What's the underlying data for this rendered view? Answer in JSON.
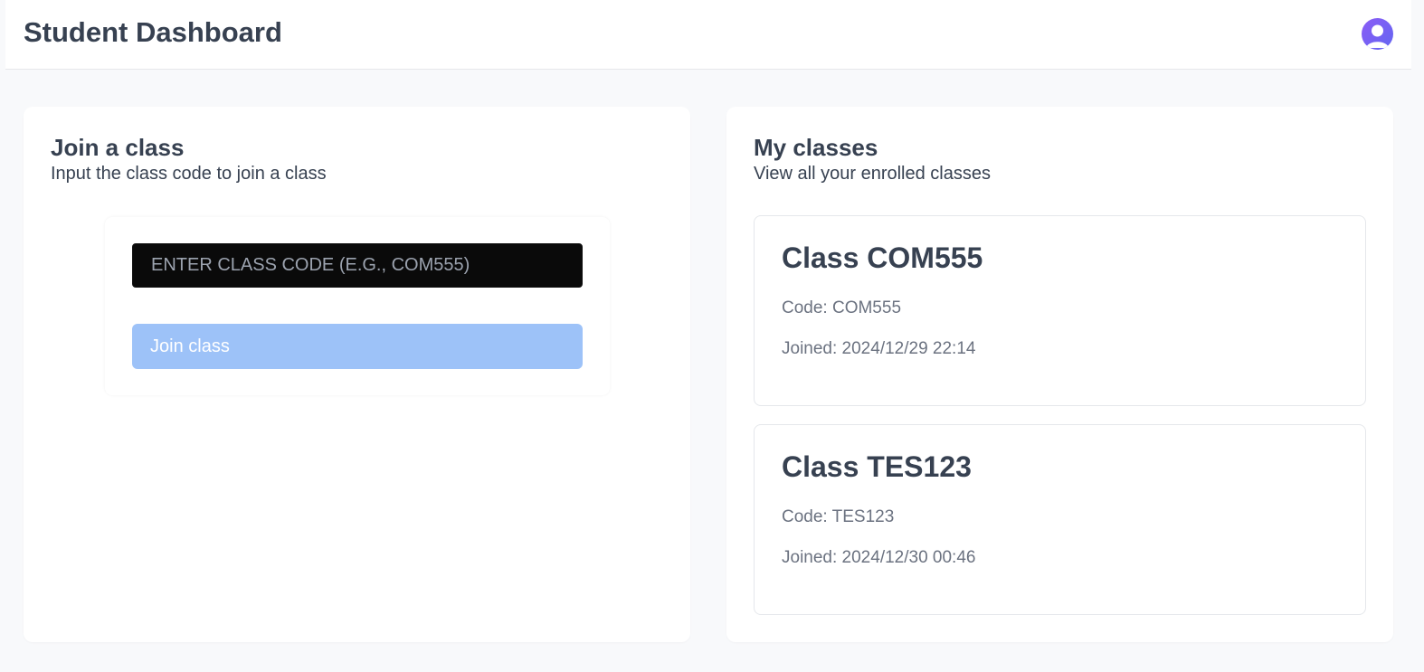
{
  "header": {
    "title": "Student Dashboard",
    "avatar_icon": "user-avatar-icon"
  },
  "join_card": {
    "title": "Join a class",
    "subtitle": "Input the class code to join a class",
    "input": {
      "value": "",
      "placeholder": "ENTER CLASS CODE (E.G., COM555)"
    },
    "button_label": "Join class"
  },
  "classes_card": {
    "title": "My classes",
    "subtitle": "View all your enrolled classes",
    "classes": [
      {
        "name": "Class COM555",
        "code": "Code: COM555",
        "joined": "Joined: 2024/12/29 22:14"
      },
      {
        "name": "Class TES123",
        "code": "Code: TES123",
        "joined": "Joined: 2024/12/30 00:46"
      }
    ]
  },
  "colors": {
    "background": "#f8f9fb",
    "card": "#ffffff",
    "text_primary": "#374151",
    "text_muted": "#6b7280",
    "input_bg": "#0a0a0a",
    "button_disabled": "#9dc2f8",
    "avatar_gradient_start": "#8b5cf6",
    "avatar_gradient_end": "#6366f1"
  }
}
